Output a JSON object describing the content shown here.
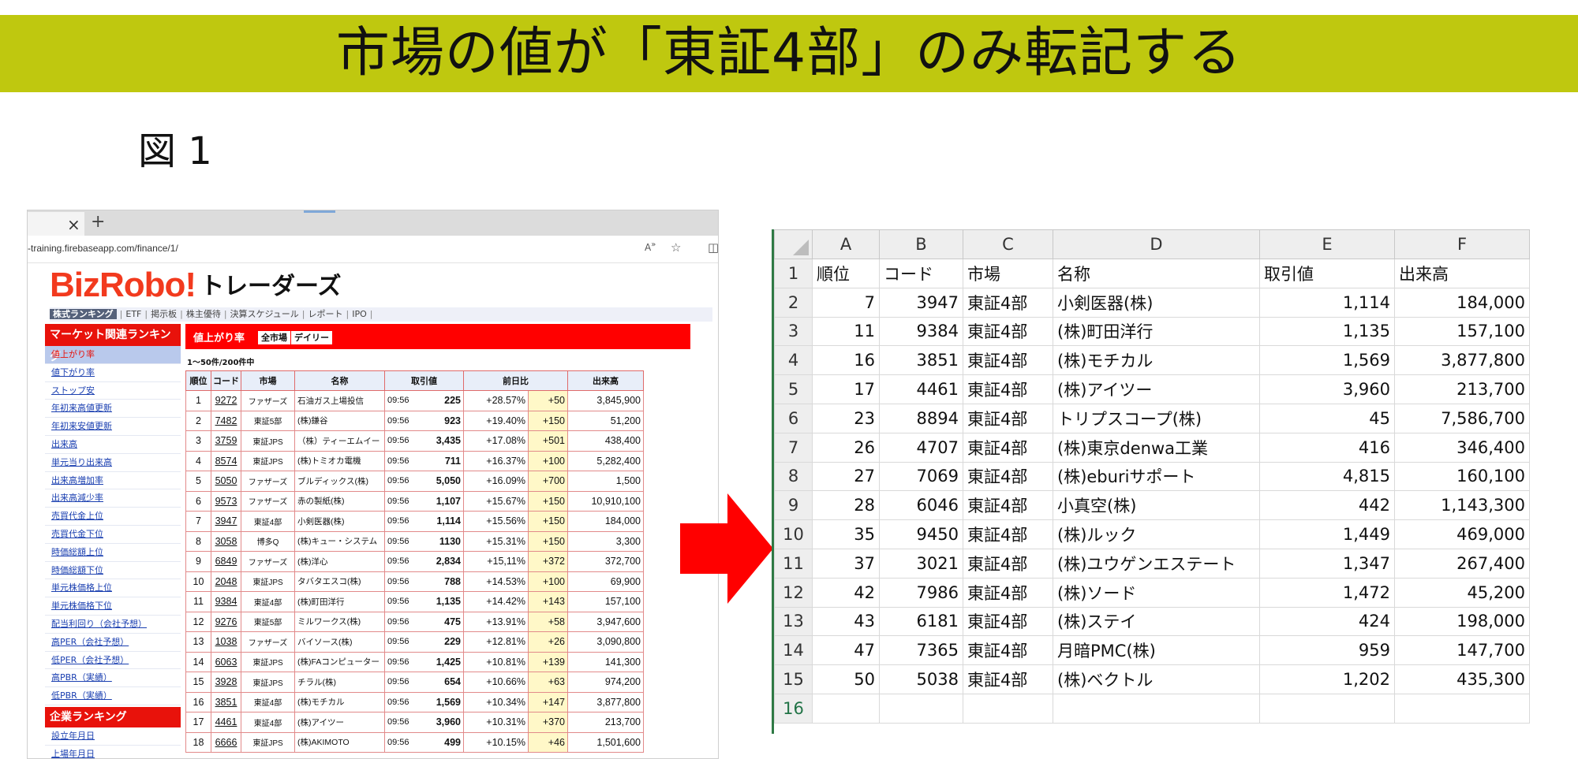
{
  "slide": {
    "title": "市場の値が「東証4部」のみ転記する",
    "figure_label": "図 1"
  },
  "browser": {
    "tab_close": "×",
    "tab_new": "+",
    "url": "-training.firebaseapp.com/finance/1/",
    "logo_text": "BizRobo!",
    "logo_suffix": "トレーダーズ",
    "nav": [
      "株式ランキング",
      "ETF",
      "掲示板",
      "株主優待",
      "決算スケジュール",
      "レポート",
      "IPO"
    ],
    "sidebar_heading": "マーケット関連ランキング",
    "sidebar_items": [
      "値上がり率",
      "値下がり率",
      "ストップ安",
      "年初来高値更新",
      "年初来安値更新",
      "出来高",
      "単元当り出来高",
      "出来高増加率",
      "出来高減少率",
      "売買代金上位",
      "売買代金下位",
      "時価総額上位",
      "時価総額下位",
      "単元株価格上位",
      "単元株価格下位",
      "配当利回り（会社予想）",
      "高PER（会社予想）",
      "低PER（会社予想）",
      "高PBR（実績）",
      "低PBR（実績）"
    ],
    "sidebar_heading2": "企業ランキング",
    "sidebar_items2": [
      "設立年月日",
      "上場年月日"
    ],
    "main_title": "値上がり率",
    "btn_all": "全市場",
    "btn_daily": "デイリー",
    "count": "1～50件/200件中",
    "headers": [
      "順位",
      "コード",
      "市場",
      "名称",
      "取引値",
      "前日比",
      "出来高"
    ],
    "rows": [
      [
        "1",
        "9272",
        "ファザーズ",
        "石油ガス上場投信",
        "09:56",
        "225",
        "+28.57%",
        "+50",
        "3,845,900"
      ],
      [
        "2",
        "7482",
        "東証5部",
        "(株)鎌谷",
        "09:56",
        "923",
        "+19.40%",
        "+150",
        "51,200"
      ],
      [
        "3",
        "3759",
        "東証JPS",
        "（株）ティーエムイー",
        "09:56",
        "3,435",
        "+17.08%",
        "+501",
        "438,400"
      ],
      [
        "4",
        "8574",
        "東証JPS",
        "(株)トミオカ電機",
        "09:56",
        "711",
        "+16.37%",
        "+100",
        "5,282,400"
      ],
      [
        "5",
        "5050",
        "ファザーズ",
        "ブルディックス(株)",
        "09:56",
        "5,050",
        "+16.09%",
        "+700",
        "1,500"
      ],
      [
        "6",
        "9573",
        "ファザーズ",
        "赤の製紙(株)",
        "09:56",
        "1,107",
        "+15.67%",
        "+150",
        "10,910,100"
      ],
      [
        "7",
        "3947",
        "東証4部",
        "小剣医器(株)",
        "09:56",
        "1,114",
        "+15.56%",
        "+150",
        "184,000"
      ],
      [
        "8",
        "3058",
        "博多Q",
        "(株)キュー・システム",
        "09:56",
        "1130",
        "+15.31%",
        "+150",
        "3,300"
      ],
      [
        "9",
        "6849",
        "ファザーズ",
        "(株)洋心",
        "09:56",
        "2,834",
        "+15,11%",
        "+372",
        "372,700"
      ],
      [
        "10",
        "2048",
        "東証JPS",
        "タバタエスコ(株)",
        "09:56",
        "788",
        "+14.53%",
        "+100",
        "69,900"
      ],
      [
        "11",
        "9384",
        "東証4部",
        "(株)町田洋行",
        "09:56",
        "1,135",
        "+14.42%",
        "+143",
        "157,100"
      ],
      [
        "12",
        "9276",
        "東証5部",
        "ミルワークス(株)",
        "09:56",
        "475",
        "+13.91%",
        "+58",
        "3,947,600"
      ],
      [
        "13",
        "1038",
        "ファザーズ",
        "バイソース(株)",
        "09:56",
        "229",
        "+12.81%",
        "+26",
        "3,090,800"
      ],
      [
        "14",
        "6063",
        "東証JPS",
        "(株)FAコンピューター",
        "09:56",
        "1,425",
        "+10.81%",
        "+139",
        "141,300"
      ],
      [
        "15",
        "3928",
        "東証JPS",
        "チラル(株)",
        "09:56",
        "654",
        "+10.66%",
        "+63",
        "974,200"
      ],
      [
        "16",
        "3851",
        "東証4部",
        "(株)モチカル",
        "09:56",
        "1,569",
        "+10.34%",
        "+147",
        "3,877,800"
      ],
      [
        "17",
        "4461",
        "東証4部",
        "(株)アイツー",
        "09:56",
        "3,960",
        "+10.31%",
        "+370",
        "213,700"
      ],
      [
        "18",
        "6666",
        "東証JPS",
        "(株)AKIMOTO",
        "09:56",
        "499",
        "+10.15%",
        "+46",
        "1,501,600"
      ]
    ]
  },
  "sheet": {
    "columns": [
      "A",
      "B",
      "C",
      "D",
      "E",
      "F"
    ],
    "rows": [
      [
        "1",
        "順位",
        "コード",
        "市場",
        "名称",
        "取引値",
        "出来高"
      ],
      [
        "2",
        "7",
        "3947",
        "東証4部",
        "小剣医器(株)",
        "1,114",
        "184,000"
      ],
      [
        "3",
        "11",
        "9384",
        "東証4部",
        "(株)町田洋行",
        "1,135",
        "157,100"
      ],
      [
        "4",
        "16",
        "3851",
        "東証4部",
        "(株)モチカル",
        "1,569",
        "3,877,800"
      ],
      [
        "5",
        "17",
        "4461",
        "東証4部",
        "(株)アイツー",
        "3,960",
        "213,700"
      ],
      [
        "6",
        "23",
        "8894",
        "東証4部",
        "トリプスコープ(株)",
        "45",
        "7,586,700"
      ],
      [
        "7",
        "26",
        "4707",
        "東証4部",
        "(株)東京denwa工業",
        "416",
        "346,400"
      ],
      [
        "8",
        "27",
        "7069",
        "東証4部",
        "(株)eburiサポート",
        "4,815",
        "160,100"
      ],
      [
        "9",
        "28",
        "6046",
        "東証4部",
        "小真空(株)",
        "442",
        "1,143,300"
      ],
      [
        "10",
        "35",
        "9450",
        "東証4部",
        "(株)ルック",
        "1,449",
        "469,000"
      ],
      [
        "11",
        "37",
        "3021",
        "東証4部",
        "(株)ユウゲンエステート",
        "1,347",
        "267,400"
      ],
      [
        "12",
        "42",
        "7986",
        "東証4部",
        "(株)ソード",
        "1,472",
        "45,200"
      ],
      [
        "13",
        "43",
        "6181",
        "東証4部",
        "(株)ステイ",
        "424",
        "198,000"
      ],
      [
        "14",
        "47",
        "7365",
        "東証4部",
        "月暗PMC(株)",
        "959",
        "147,700"
      ],
      [
        "15",
        "50",
        "5038",
        "東証4部",
        "(株)ベクトル",
        "1,202",
        "435,300"
      ],
      [
        "16",
        "",
        "",
        "",
        "",
        "",
        ""
      ]
    ]
  },
  "colors": {
    "banner": "#bfc80f",
    "accent_red": "#ff0000",
    "excel_green": "#217346"
  }
}
